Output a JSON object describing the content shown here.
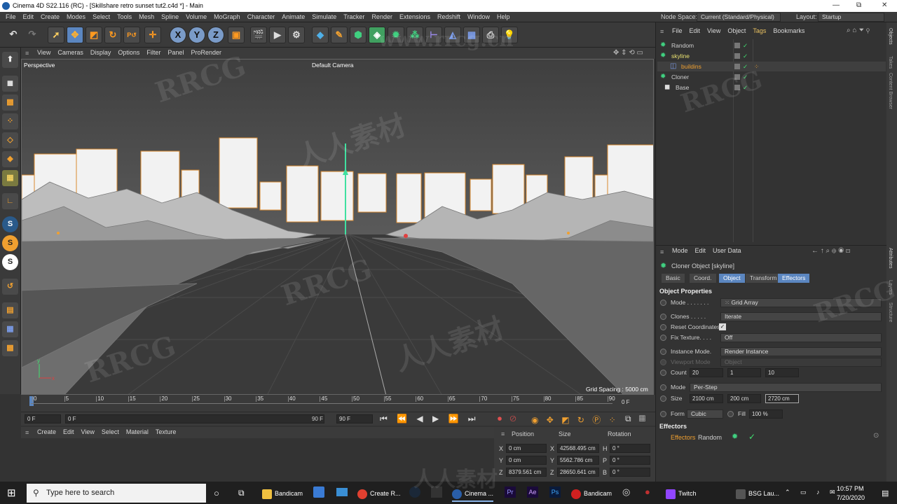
{
  "window": {
    "title": "Cinema 4D S22.116 (RC) - [Skillshare retro sunset tut2.c4d *] - Main",
    "min": "—",
    "max": "⧉",
    "close": "✕"
  },
  "menubar": {
    "items": [
      "File",
      "Edit",
      "Create",
      "Modes",
      "Select",
      "Tools",
      "Mesh",
      "Spline",
      "Volume",
      "MoGraph",
      "Character",
      "Animate",
      "Simulate",
      "Tracker",
      "Render",
      "Extensions",
      "Redshift",
      "Window",
      "Help"
    ],
    "node_space_label": "Node Space:",
    "node_space_value": "Current (Standard/Physical)",
    "layout_label": "Layout:",
    "layout_value": "Startup"
  },
  "toolbar": {
    "x": "X",
    "y": "Y",
    "z": "Z"
  },
  "viewport": {
    "menu": [
      "View",
      "Cameras",
      "Display",
      "Options",
      "Filter",
      "Panel",
      "ProRender"
    ],
    "name": "Perspective",
    "camera": "Default Camera",
    "grid_spacing": "Grid Spacing : 5000 cm"
  },
  "timeline": {
    "ticks": [
      "0",
      "5",
      "10",
      "15",
      "20",
      "25",
      "30",
      "35",
      "40",
      "45",
      "50",
      "55",
      "60",
      "65",
      "70",
      "75",
      "80",
      "85",
      "90"
    ],
    "end_frame": "0 F",
    "start_field": "0 F",
    "current_field": "0 F",
    "max_field": "90 F",
    "end_field": "90 F"
  },
  "material": {
    "menu": [
      "Create",
      "Edit",
      "View",
      "Select",
      "Material",
      "Texture"
    ]
  },
  "coords": {
    "headers": [
      "Position",
      "Size",
      "Rotation"
    ],
    "rows": [
      {
        "axis": "X",
        "pos": "0 cm",
        "sl": "X",
        "size": "42568.495 cm",
        "rl": "H",
        "rot": "0 °"
      },
      {
        "axis": "Y",
        "pos": "0 cm",
        "sl": "Y",
        "size": "5562.786 cm",
        "rl": "P",
        "rot": "0 °"
      },
      {
        "axis": "Z",
        "pos": "8379.561 cm",
        "sl": "Z",
        "size": "28650.641 cm",
        "rl": "B",
        "rot": "0 °"
      }
    ]
  },
  "objects": {
    "menu": [
      "File",
      "Edit",
      "View",
      "Object",
      "Tags",
      "Bookmarks"
    ],
    "items": [
      {
        "name": "Random",
        "color": "#cfcfcf"
      },
      {
        "name": "skyline",
        "color": "#e8e070"
      },
      {
        "name": "buildins",
        "color": "#f0a030"
      },
      {
        "name": "Cloner",
        "color": "#cfcfcf"
      },
      {
        "name": "Base",
        "color": "#cfcfcf"
      }
    ]
  },
  "attributes": {
    "menu": [
      "Mode",
      "Edit",
      "User Data"
    ],
    "object_title": "Cloner Object [skyline]",
    "tabs": [
      "Basic",
      "Coord.",
      "Object",
      "Transform",
      "Effectors"
    ],
    "section": "Object Properties",
    "mode_label": "Mode . . . . . . .",
    "mode_value": "Grid Array",
    "clones_label": "Clones . . . . .",
    "clones_value": "Iterate",
    "reset_label": "Reset Coordinates",
    "fix_label": "Fix Texture. . . .",
    "fix_value": "Off",
    "instance_label": "Instance Mode.",
    "instance_value": "Render Instance",
    "viewport_mode_label": "Viewport Mode",
    "viewport_mode_value": "Object",
    "count_label": "Count",
    "count": [
      "20",
      "1",
      "10"
    ],
    "mode2_label": "Mode",
    "mode2_value": "Per-Step",
    "size_label": "Size",
    "size": [
      "2100 cm",
      "200 cm",
      "2720 cm"
    ],
    "form_label": "Form",
    "form_value": "Cubic",
    "fill_label": "Fill",
    "fill_value": "100 %",
    "effectors_section": "Effectors",
    "effectors_label": "Effectors",
    "effector_item": "Random"
  },
  "side_tabs": [
    "Objects",
    "Takes",
    "Content Browser",
    "Attributes",
    "Layers",
    "Structure"
  ],
  "taskbar": {
    "search": "Type here to search",
    "apps": [
      "Bandicam",
      "Create R...",
      "Cinema ...",
      "Bandicam",
      "Twitch",
      "BSG Lau..."
    ],
    "time": "10:57 PM",
    "date": "7/20/2020"
  },
  "watermarks": [
    "RRCG",
    "人人素材",
    "www.rrcg.cn"
  ]
}
